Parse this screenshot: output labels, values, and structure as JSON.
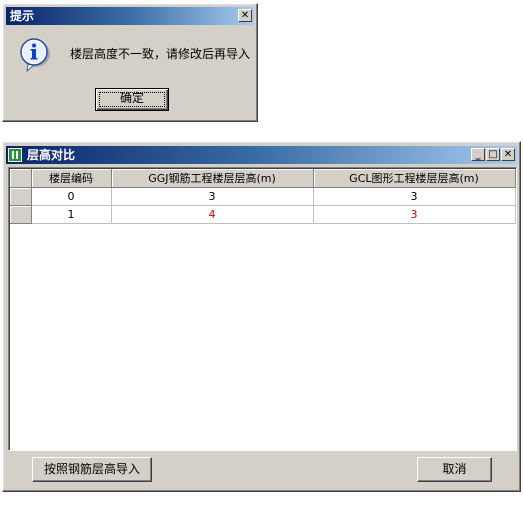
{
  "dialog": {
    "title": "提示",
    "close_glyph": "✕",
    "message": "楼层高度不一致，请修改后再导入",
    "ok_label": "确定",
    "icon": "info-icon"
  },
  "compare": {
    "title": "层高对比",
    "title_icon": "table-icon",
    "min_glyph": "_",
    "max_glyph": "□",
    "close_glyph": "✕",
    "columns": [
      "楼层编码",
      "GGJ钢筋工程楼层层高(m)",
      "GCL图形工程楼层层高(m)"
    ],
    "rows": [
      {
        "code": "0",
        "ggj": "3",
        "gcl": "3",
        "mismatch": false
      },
      {
        "code": "1",
        "ggj": "4",
        "gcl": "3",
        "mismatch": true
      }
    ],
    "mismatch_color": "#cc0000",
    "import_label": "按照钢筋层高导入",
    "cancel_label": "取消"
  },
  "colors": {
    "title_start": "#0a246a",
    "title_end": "#a6caf0",
    "face": "#d4d0c8"
  }
}
